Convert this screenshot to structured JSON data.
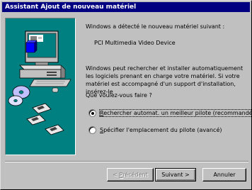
{
  "window": {
    "title": "Assistant Ajout de nouveau matériel"
  },
  "content": {
    "intro": "Windows a détecté le nouveau matériel suivant :",
    "device": "PCI Multimedia Video Device",
    "paragraph": "Windows peut rechercher et installer automatiquement les logiciels prenant en charge votre matériel. Si votre matériel est accompagné d'un support d'installation, insérez-le",
    "question": "Que voulez-vous faire ?"
  },
  "options": [
    {
      "prefix": "",
      "hotkey": "R",
      "rest": "echercher automat. un meilleur pilote (recommandé)",
      "selected": true
    },
    {
      "prefix": "",
      "hotkey": "S",
      "rest": "pécifier l'emplacement du pilote (avancé)",
      "selected": false
    }
  ],
  "buttons": {
    "previous": {
      "prefix": "< ",
      "hotkey": "P",
      "rest": "récédent",
      "enabled": false
    },
    "next": "Suivant >",
    "cancel": "Annuler"
  },
  "icons": [
    "computer-icon",
    "cd-disc-icon",
    "floppy-disk-icon"
  ],
  "colors": {
    "titlebar": "#000080",
    "illustration_bg": "#008080",
    "face": "#c0c0c0"
  }
}
